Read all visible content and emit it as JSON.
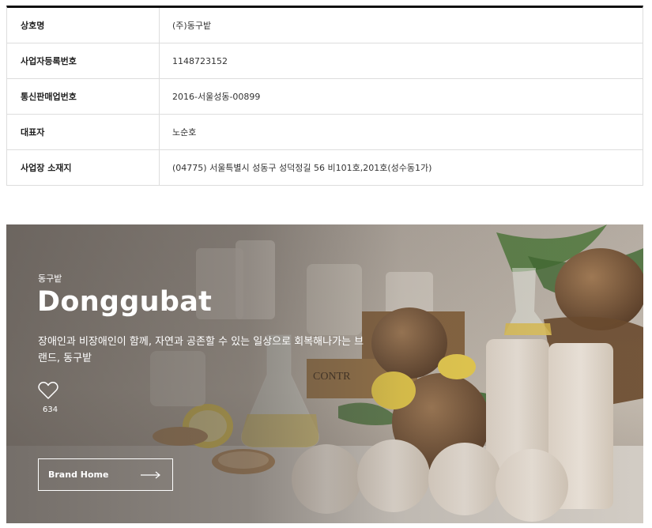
{
  "company_info": {
    "rows": [
      {
        "label": "상호명",
        "value": "(주)동구밭"
      },
      {
        "label": "사업자등록번호",
        "value": "1148723152"
      },
      {
        "label": "통신판매업번호",
        "value": "2016-서울성동-00899"
      },
      {
        "label": "대표자",
        "value": "노순호"
      },
      {
        "label": "사업장 소재지",
        "value": "(04775) 서울특별시 성동구 성덕정길 56 비101호,201호(성수동1가)"
      }
    ]
  },
  "brand": {
    "subtitle": "동구밭",
    "name": "Donggubat",
    "description": "장애인과 비장애인이 함께, 자연과 공존할 수 있는 일상으로 회복해나가는 브랜드, 동구밭",
    "like_count": "634",
    "like_icon": "heart-outline-icon",
    "home_button_label": "Brand Home",
    "home_button_icon": "arrow-right-icon"
  }
}
